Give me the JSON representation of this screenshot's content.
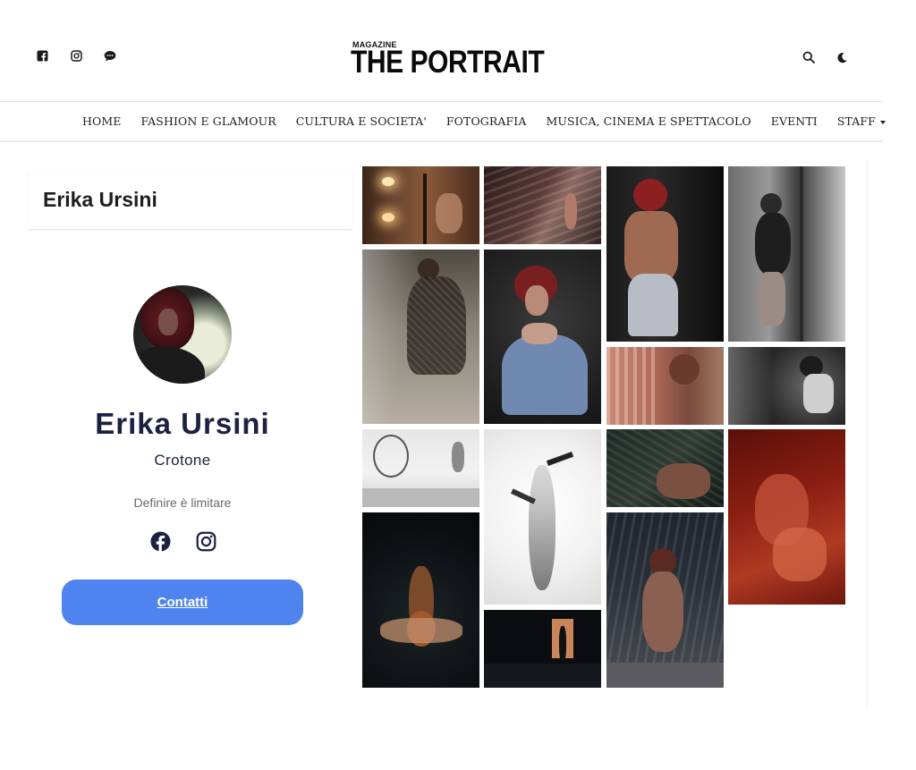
{
  "header": {
    "logo_small": "MAGAZINE",
    "logo_big": "THE PORTRAIT",
    "social_icons": [
      "facebook-icon",
      "instagram-icon",
      "chat-icon"
    ],
    "right_icons": [
      "search-icon",
      "moon-icon"
    ]
  },
  "nav": {
    "items": [
      "HOME",
      "FASHION E GLAMOUR",
      "CULTURA E SOCIETA'",
      "FOTOGRAFIA",
      "MUSICA, CINEMA E SPETTACOLO",
      "EVENTI",
      "STAFF"
    ]
  },
  "profile": {
    "box_title": "Erika Ursini",
    "name": "Erika Ursini",
    "city": "Crotone",
    "tagline": "Definire è limitare",
    "social_icons": [
      "facebook-icon",
      "instagram-icon"
    ],
    "contact_label": "Contatti"
  },
  "colors": {
    "name_text": "#1c2140",
    "button": "#4f84ee"
  }
}
